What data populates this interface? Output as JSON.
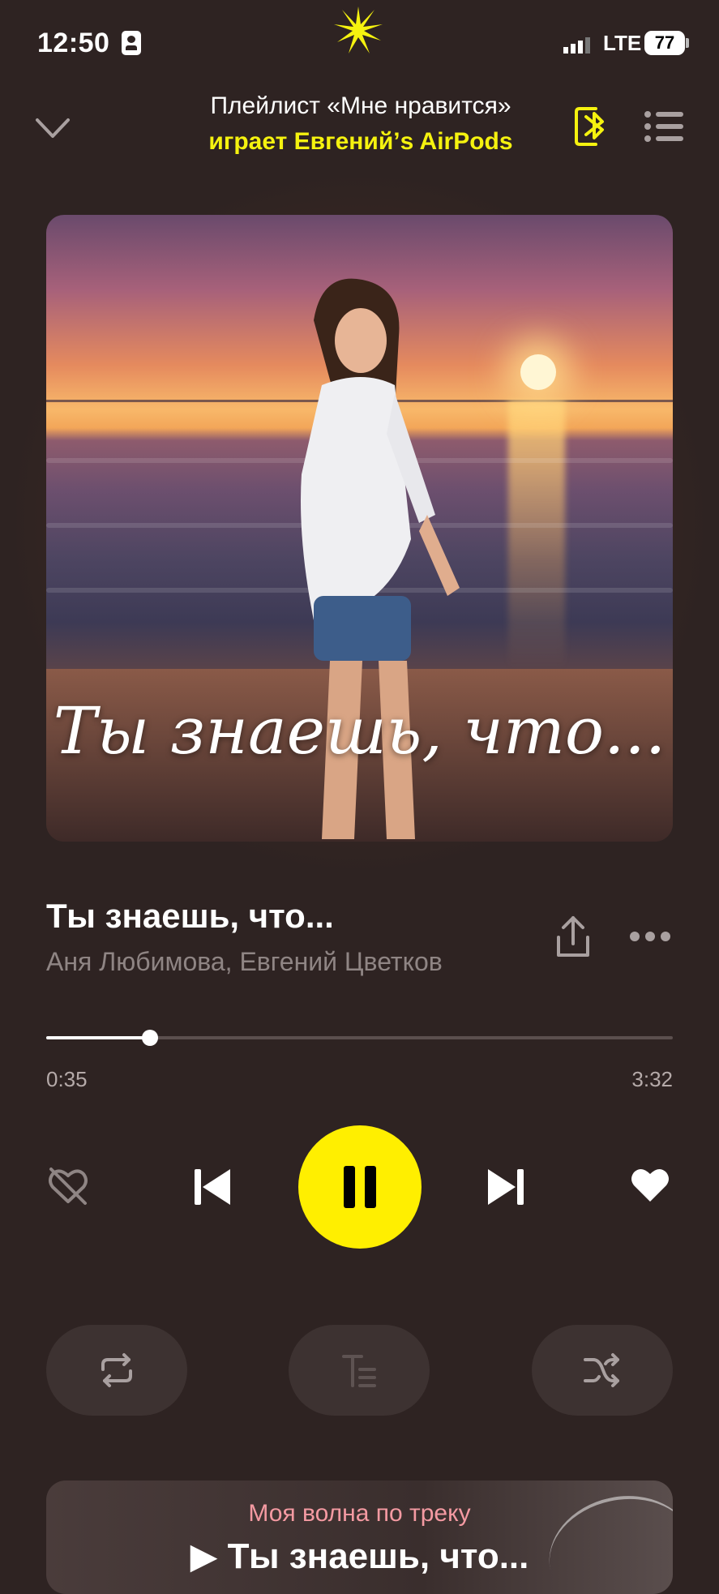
{
  "status_bar": {
    "time": "12:50",
    "network": "LTE",
    "battery": "77"
  },
  "header": {
    "title": "Плейлист «Мне нравится»",
    "subtitle": "играет Евгений’s AirPods",
    "accent_color": "#f5f20f"
  },
  "cover": {
    "caption": "Ты знаешь, что..."
  },
  "track": {
    "title": "Ты знаешь, что...",
    "artists": "Аня Любимова, Евгений Цветков"
  },
  "progress": {
    "elapsed": "0:35",
    "total": "3:32",
    "fraction": 0.165
  },
  "controls": {
    "dislike_icon": "dislike-icon",
    "prev_icon": "previous-track-icon",
    "play_state": "playing",
    "next_icon": "next-track-icon",
    "like_icon": "heart-icon",
    "play_button_color": "#ffef00"
  },
  "bottom_actions": [
    "repeat-icon",
    "lyrics-icon",
    "shuffle-icon"
  ],
  "wave_card": {
    "label": "Моя волна по треку",
    "track": "▶ Ты знаешь, что..."
  }
}
